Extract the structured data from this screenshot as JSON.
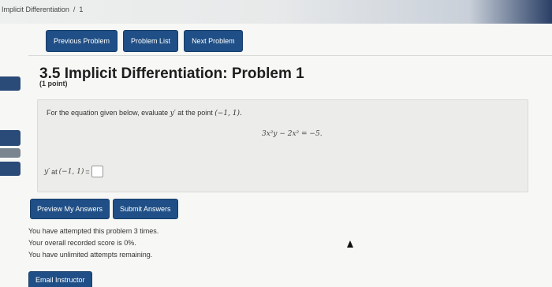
{
  "breadcrumb": {
    "section": "Implicit Differentiation",
    "separator": "/",
    "page": "1"
  },
  "nav": {
    "previous": "Previous Problem",
    "list": "Problem List",
    "next": "Next Problem"
  },
  "problem": {
    "title": "3.5 Implicit Differentiation: Problem 1",
    "points": "(1 point)",
    "prompt_text": "For the equation given below, evaluate ",
    "prompt_var": "y′",
    "prompt_mid": " at the point ",
    "prompt_point": "(−1, 1).",
    "equation": "3x²y − 2x² = −5.",
    "answer_label_var": "y′",
    "answer_label_text": " at ",
    "answer_label_point": "(−1, 1)",
    "answer_equals": " = "
  },
  "actions": {
    "preview": "Preview My Answers",
    "submit": "Submit Answers"
  },
  "status": {
    "attempts": "You have attempted this problem 3 times.",
    "score": "Your overall recorded score is 0%.",
    "remaining": "You have unlimited attempts remaining."
  },
  "footer": {
    "email": "Email Instructor"
  },
  "colors": {
    "button": "#1f4f86",
    "problem_bg": "#ececea"
  }
}
